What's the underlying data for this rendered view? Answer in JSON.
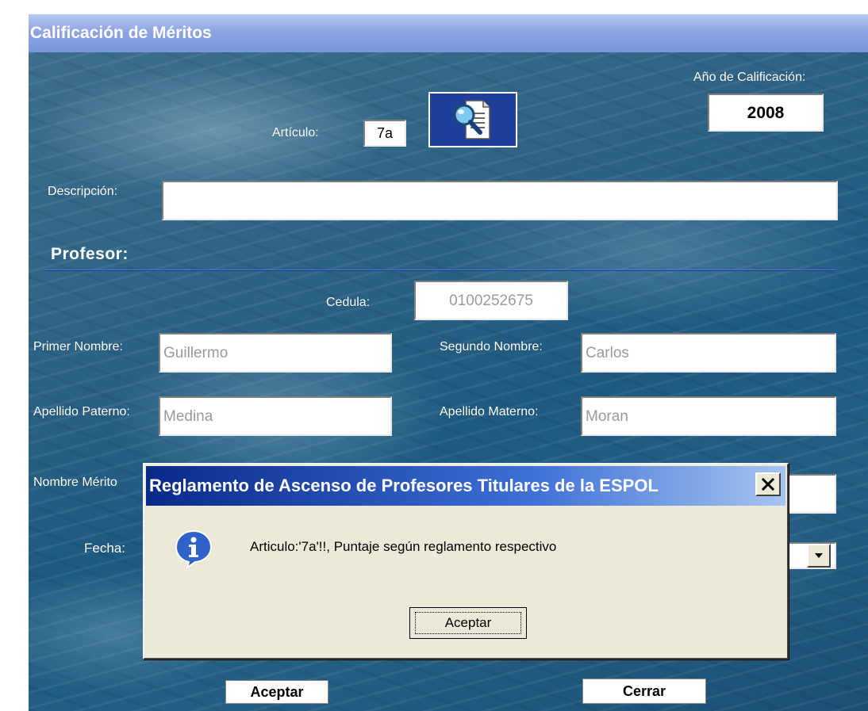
{
  "window": {
    "title": "Calificación de Méritos"
  },
  "form": {
    "year_label": "Año de Calificación:",
    "year_value": "2008",
    "article_label": "Artículo:",
    "article_value": "7a",
    "description_label": "Descripción:",
    "description_value": "",
    "section_title": "Profesor:",
    "cedula_label": "Cedula:",
    "cedula_value": "0100252675",
    "first_name_label": "Primer Nombre:",
    "first_name_value": "Guillermo",
    "second_name_label": "Segundo Nombre:",
    "second_name_value": "Carlos",
    "paternal_label": "Apellido Paterno:",
    "paternal_value": "Medina",
    "maternal_label": "Apellido Materno:",
    "maternal_value": "Moran",
    "merit_name_label": "Nombre Mérito",
    "merit_name_value": "",
    "date_label": "Fecha:",
    "accept_label": "Aceptar",
    "close_label": "Cerrar"
  },
  "dialog": {
    "title": "Reglamento de Ascenso de Profesores Titulares de la ESPOL",
    "message": "Articulo:'7a'!!,  Puntaje según reglamento respectivo",
    "ok_label": "Aceptar",
    "icon": "info-icon",
    "close_icon": "close-icon"
  },
  "colors": {
    "title_gradient": "#8ea5e2",
    "dialog_title": "#0a2a8a",
    "dialog_bg": "#ece9d8",
    "search_button_bg": "#1f3f9a"
  }
}
